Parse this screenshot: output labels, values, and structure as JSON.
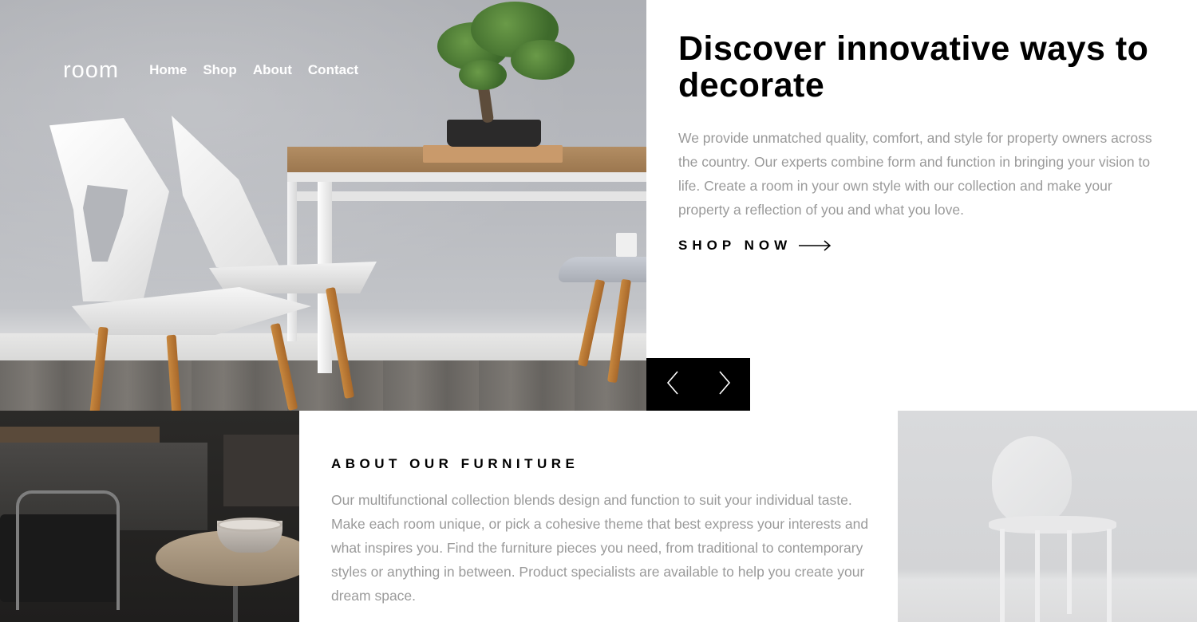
{
  "nav": {
    "logo": "room",
    "links": [
      "Home",
      "Shop",
      "About",
      "Contact"
    ]
  },
  "hero": {
    "title": "Discover innovative ways to decorate",
    "body": "We provide unmatched quality, comfort, and style for property owners across the country. Our experts combine form and function in bringing your vision to life. Create a room in your own style with our collection and make your property a reflection of you and what you love.",
    "cta_label": "SHOP NOW",
    "cta_icon": "arrow-right-icon"
  },
  "slider": {
    "prev_icon": "chevron-left-icon",
    "next_icon": "chevron-right-icon"
  },
  "about": {
    "heading": "ABOUT OUR FURNITURE",
    "body": "Our multifunctional collection blends design and function to suit your individual taste. Make each room unique, or pick a cohesive theme that best express your interests and what inspires you. Find the furniture pieces you need, from traditional to contemporary styles or anything in between. Product specialists are available to help you create your dream space."
  },
  "colors": {
    "text_primary": "#000000",
    "text_secondary": "#9a9a9a",
    "nav_text": "#ffffff",
    "slider_bg": "#000000",
    "page_bg": "#ffffff"
  }
}
